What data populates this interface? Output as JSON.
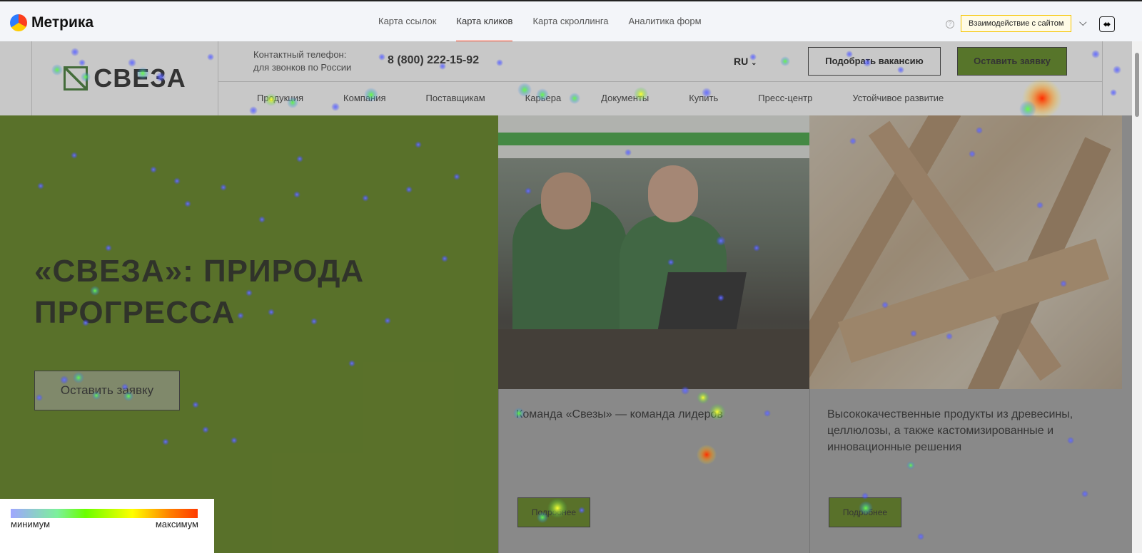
{
  "app": {
    "name": "Метрика"
  },
  "tabs": [
    {
      "label": "Карта ссылок"
    },
    {
      "label": "Карта кликов"
    },
    {
      "label": "Карта скроллинга"
    },
    {
      "label": "Аналитика форм"
    }
  ],
  "active_tab": "Карта кликов",
  "toolbar": {
    "help": "?",
    "interaction_label": "Взаимодействие с сайтом",
    "chevron": "⌵",
    "extra_icon": "⬌"
  },
  "site": {
    "logo_text": "СВЕЗА",
    "contact_line1": "Контактный телефон:",
    "contact_line2": "для звонков по России",
    "phone": "8 (800) 222-15-92",
    "lang": "RU",
    "vacancy_button": "Подобрать вакансию",
    "request_button": "Оставить заявку",
    "nav": [
      "Продукция",
      "Компания",
      "Поставщикам",
      "Карьера",
      "Документы",
      "Купить",
      "Пресс-центр",
      "Устойчивое развитие"
    ],
    "hero": {
      "title": "«СВЕЗА»: ПРИРОДА ПРОГРЕССА",
      "button": "Оставить заявку"
    },
    "cards": [
      {
        "title": "Команда «Свезы» — команда лидеров",
        "button": "Подробнее"
      },
      {
        "title": "Высококачественные продукты из древесины, целлюлозы, а также кастомизированные и инновационные решения",
        "button": "Подробнее"
      }
    ]
  },
  "legend": {
    "min": "минимум",
    "max": "максимум"
  },
  "colors": {
    "brand_green": "#4d7300",
    "tab_accent": "#fc3f1d",
    "interaction_border": "#f5c400"
  }
}
